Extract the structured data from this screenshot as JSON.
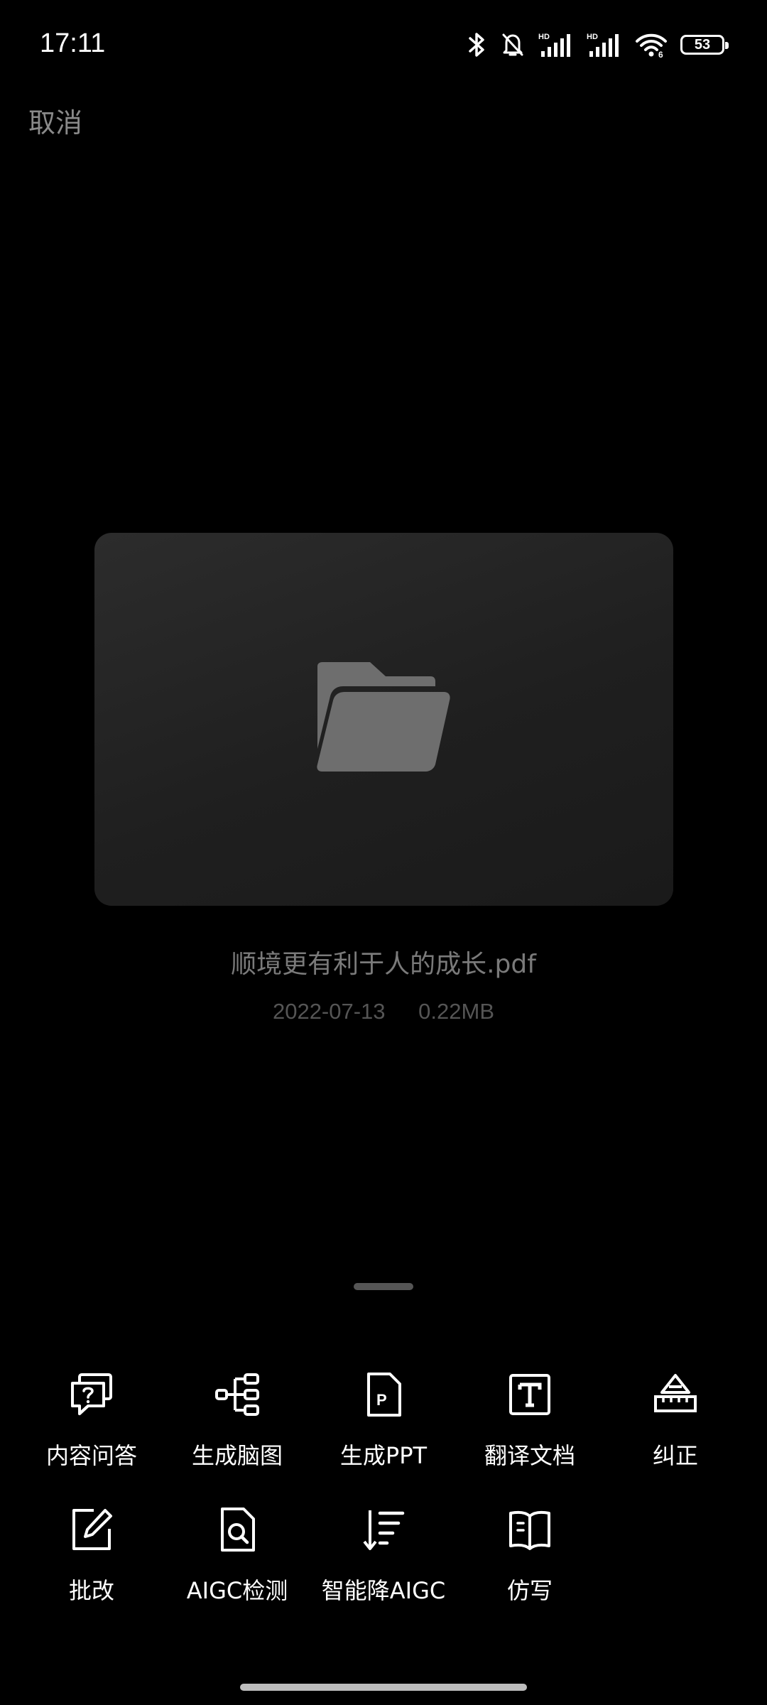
{
  "status_bar": {
    "time": "17:11",
    "battery_level": "53",
    "icons": [
      "bluetooth-icon",
      "mute-bell-icon",
      "hd-signal-icon",
      "hd-signal-icon",
      "wifi-icon",
      "battery-icon"
    ]
  },
  "header": {
    "cancel_label": "取消"
  },
  "file": {
    "name": "顺境更有利于人的成长.pdf",
    "date": "2022-07-13",
    "size": "0.22MB",
    "icon": "folder-icon"
  },
  "actions": {
    "row1": [
      {
        "label": "内容问答",
        "icon": "qa-bubble-icon"
      },
      {
        "label": "生成脑图",
        "icon": "mindmap-icon"
      },
      {
        "label": "生成PPT",
        "icon": "ppt-file-icon"
      },
      {
        "label": "翻译文档",
        "icon": "translate-text-icon"
      },
      {
        "label": "纠正",
        "icon": "ruler-correct-icon"
      }
    ],
    "row2": [
      {
        "label": "批改",
        "icon": "edit-pencil-icon"
      },
      {
        "label": "AIGC检测",
        "icon": "doc-search-icon"
      },
      {
        "label": "智能降AIGC",
        "icon": "sort-down-icon"
      },
      {
        "label": "仿写",
        "icon": "open-book-icon"
      }
    ]
  },
  "colors": {
    "background": "#000000",
    "card": "#262626",
    "muted_text": "#7a7a7a",
    "icon_gray": "#6e6e6e"
  }
}
